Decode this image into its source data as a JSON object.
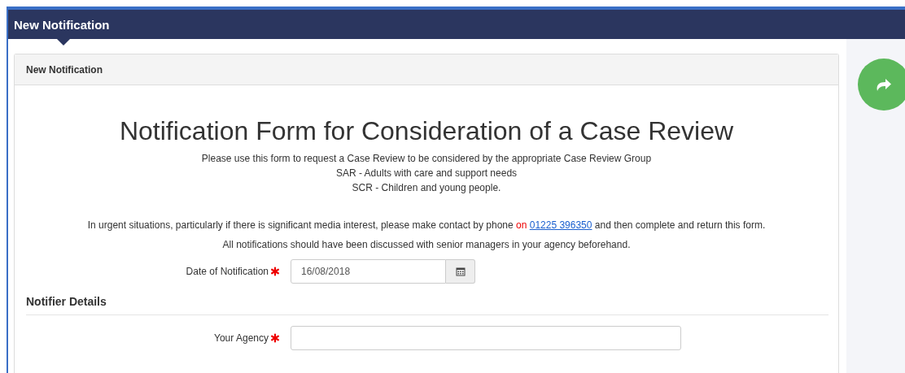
{
  "header": {
    "title": "New Notification"
  },
  "panel": {
    "heading": "New Notification",
    "form_title": "Notification Form for Consideration of a Case Review",
    "intro_lines": [
      "Please use this form to request a Case Review to be considered by the appropriate Case Review Group",
      "SAR - Adults with care and support needs",
      "SCR - Children and young people."
    ],
    "urgent": {
      "before": "In urgent situations, particularly if there is significant media interest, please make contact by phone ",
      "highlight": "on",
      "link": "01225 396350",
      "after": " and then complete and return this form."
    },
    "note": "All notifications should have been discussed with senior managers in your agency beforehand.",
    "items": [
      {
        "kind": "date",
        "label": "Date of Notification",
        "required": true,
        "value": "16/08/2018"
      },
      {
        "kind": "section",
        "title": "Notifier Details"
      },
      {
        "kind": "text",
        "label": "Your Agency",
        "required": true,
        "value": ""
      }
    ]
  },
  "fab": {
    "kind": "forward"
  }
}
